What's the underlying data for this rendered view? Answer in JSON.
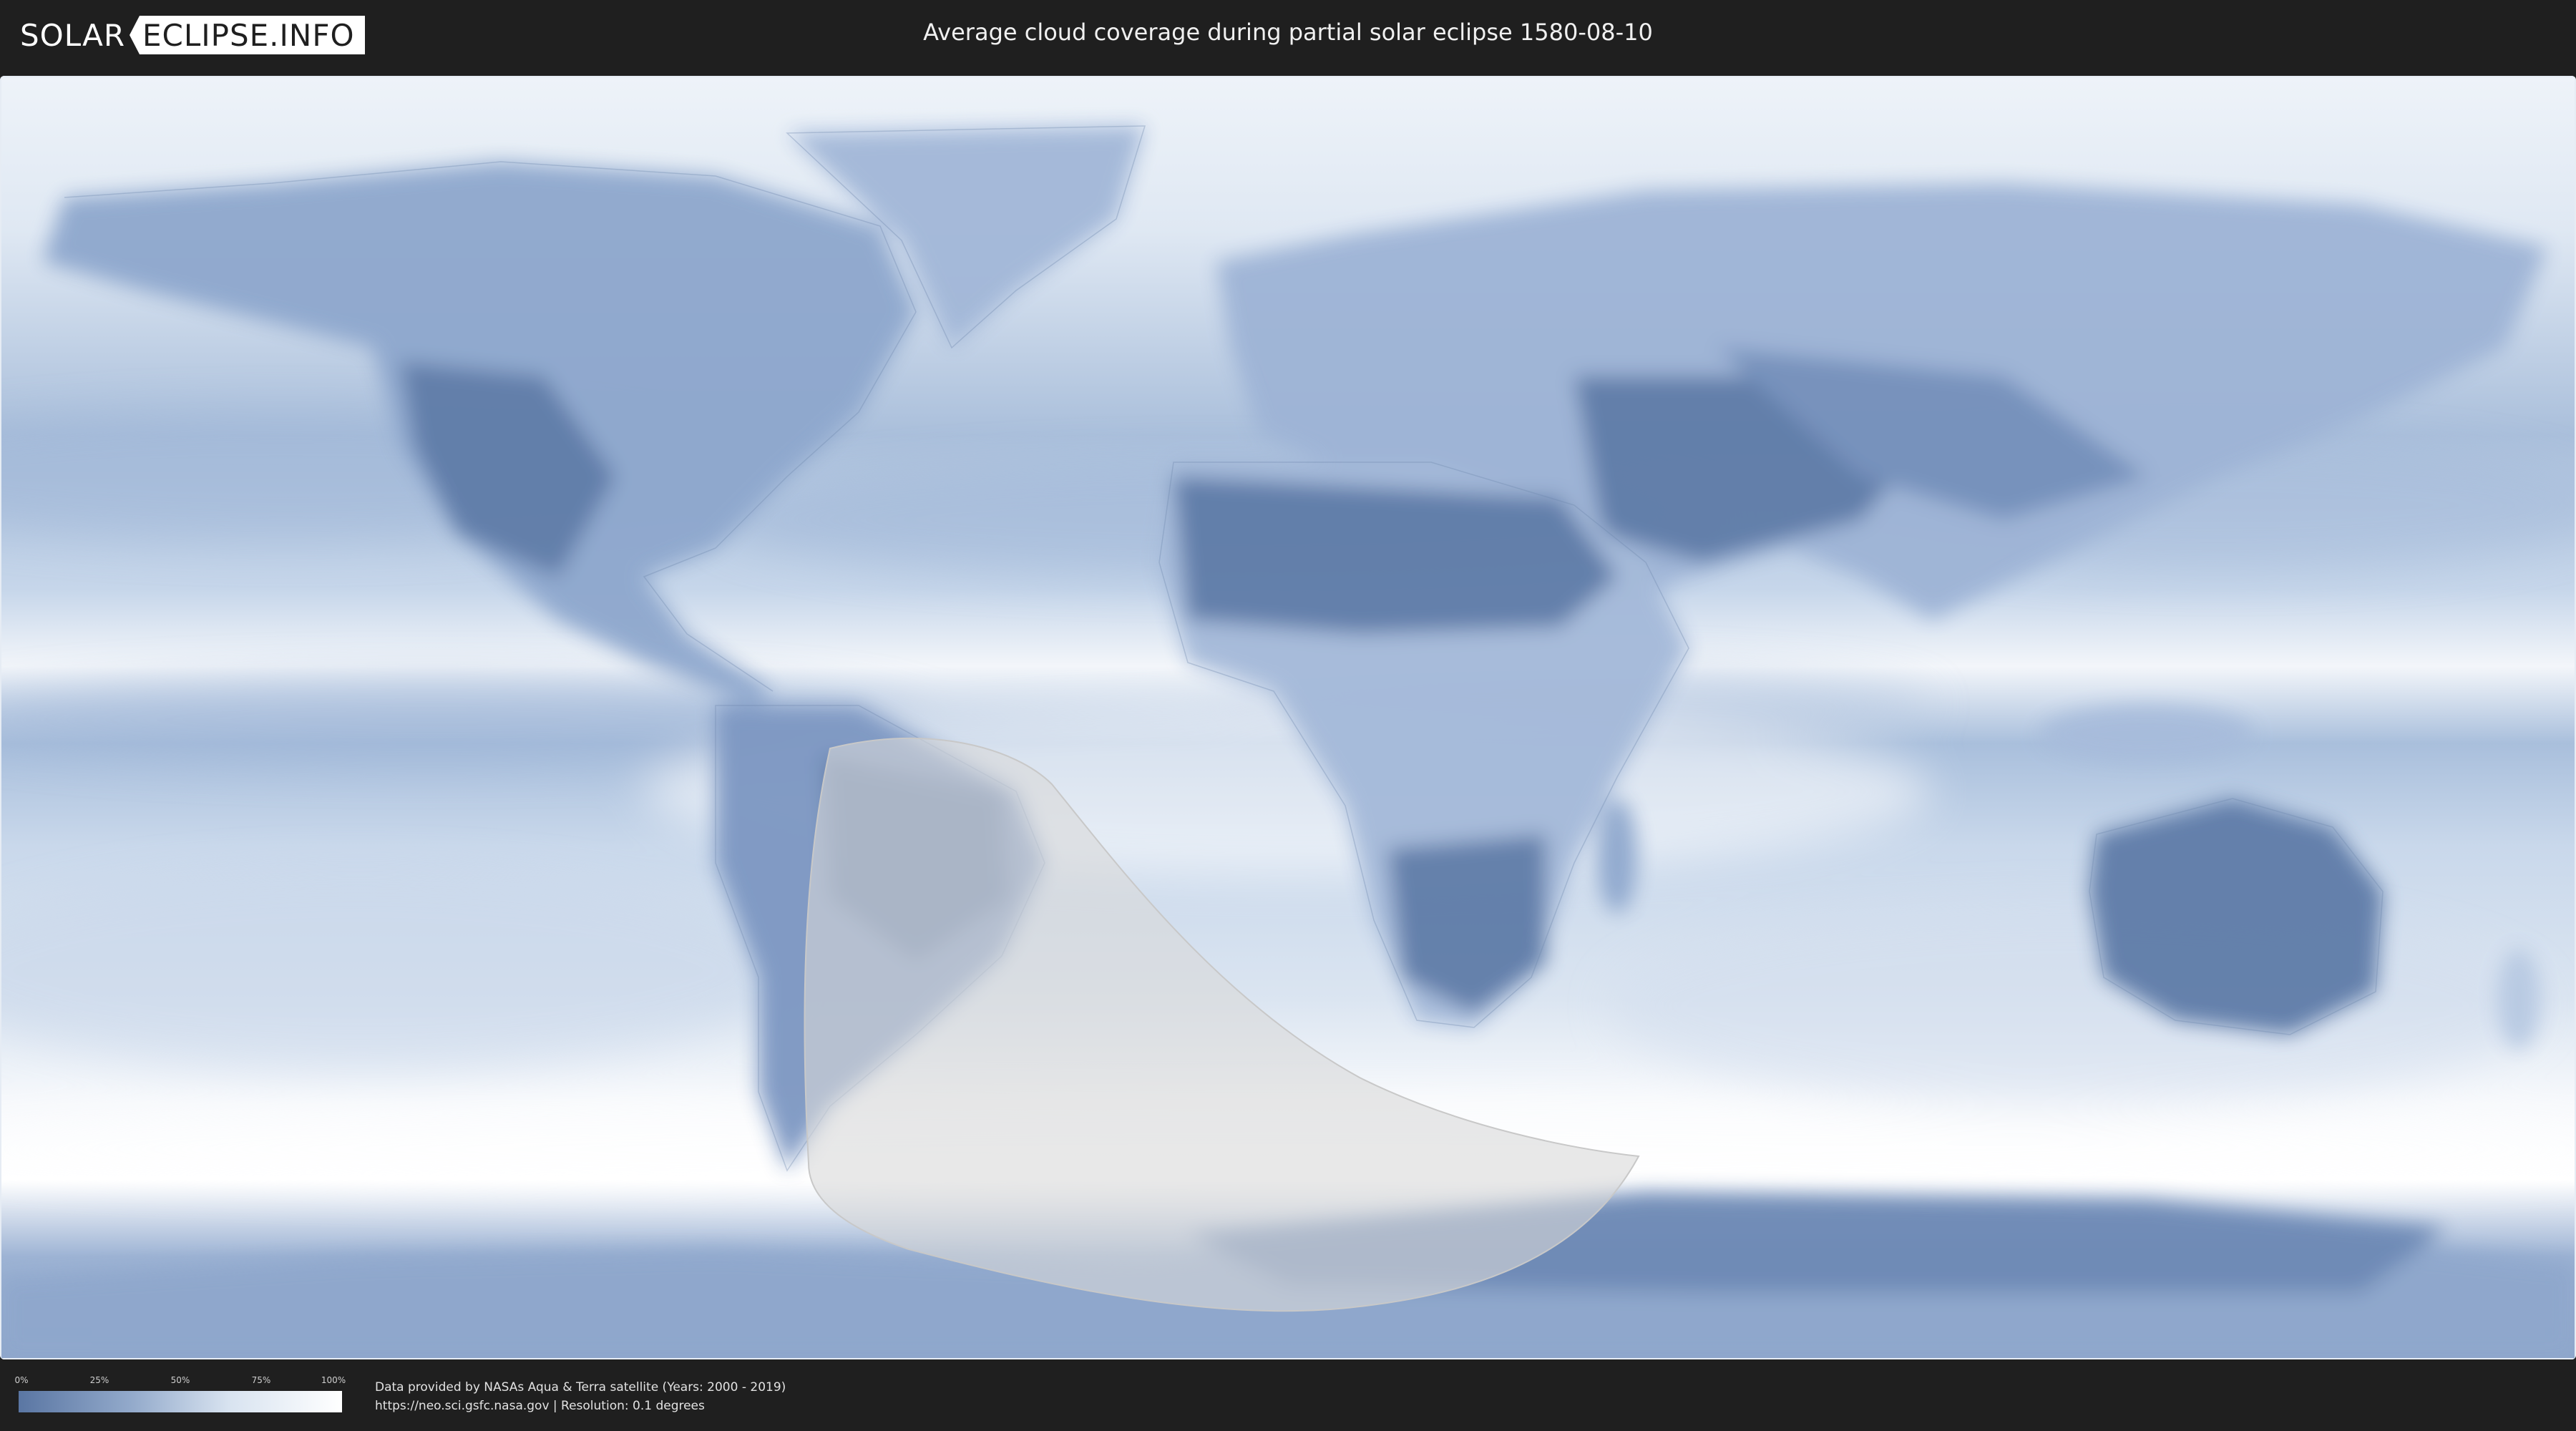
{
  "header": {
    "logo_solar": "SOLAR",
    "logo_eclipse": "ECLIPSE.INFO",
    "title": "Average cloud coverage during partial solar eclipse 1580-08-10"
  },
  "legend": {
    "ticks": [
      "0%",
      "25%",
      "50%",
      "75%",
      "100%"
    ],
    "colors": {
      "low": "#5a76a3",
      "mid": "#93aacb",
      "high": "#ffffff"
    }
  },
  "credits": {
    "line1": "Data provided by NASAs Aqua & Terra satellite (Years: 2000 - 2019)",
    "line2": "https://neo.sci.gsfc.nasa.gov | Resolution: 0.1 degrees"
  },
  "map": {
    "projection": "equirectangular",
    "eclipse_zone_color": "#d9d9d9",
    "land_clear_color": "#5f7ba8",
    "cloud_color": "#ffffff"
  }
}
